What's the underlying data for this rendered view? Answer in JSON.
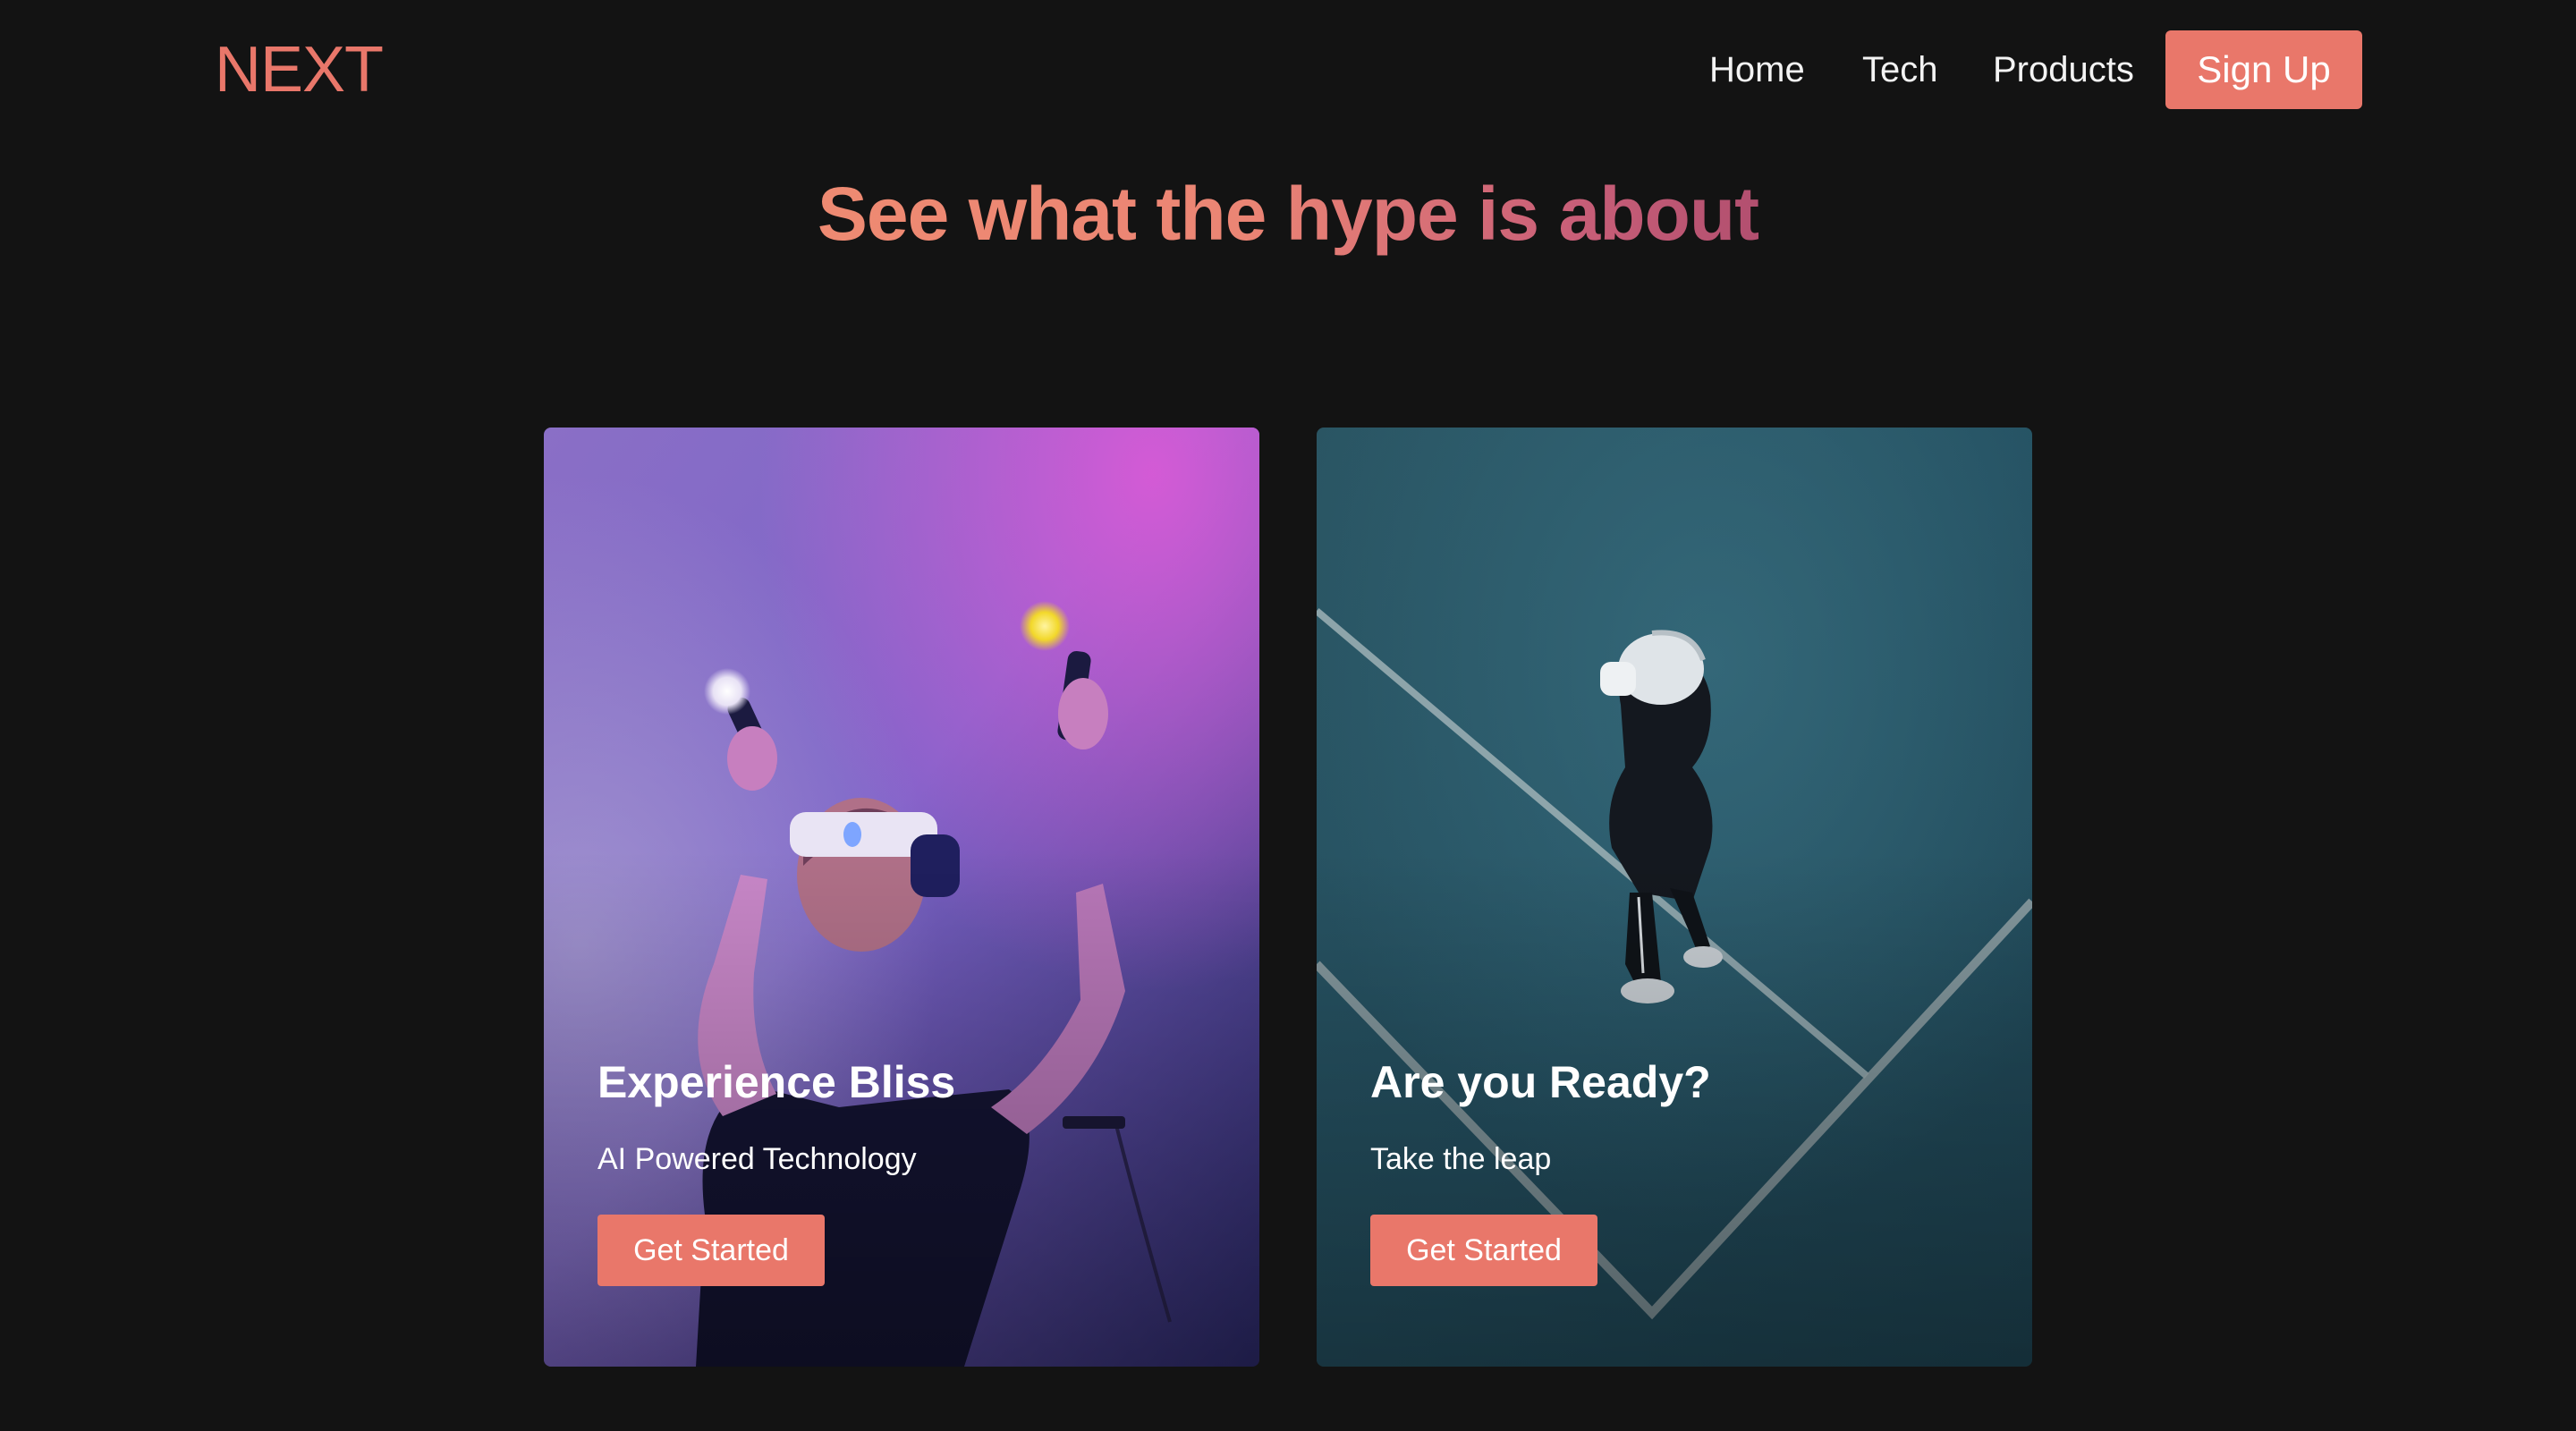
{
  "brand": {
    "logo": "NEXT",
    "accent_color": "#e9776a"
  },
  "nav": {
    "links": [
      "Home",
      "Tech",
      "Products"
    ],
    "signup_label": "Sign Up"
  },
  "hero": {
    "title": "See what the hype is about"
  },
  "cards": [
    {
      "title": "Experience Bliss",
      "subtitle": "AI Powered Technology",
      "button_label": "Get Started",
      "image": "person-wearing-vr-headset-with-motion-controllers"
    },
    {
      "title": "Are you Ready?",
      "subtitle": "Take the leap",
      "button_label": "Get Started",
      "image": "person-in-vr-headset-walking-on-teal-court"
    }
  ]
}
